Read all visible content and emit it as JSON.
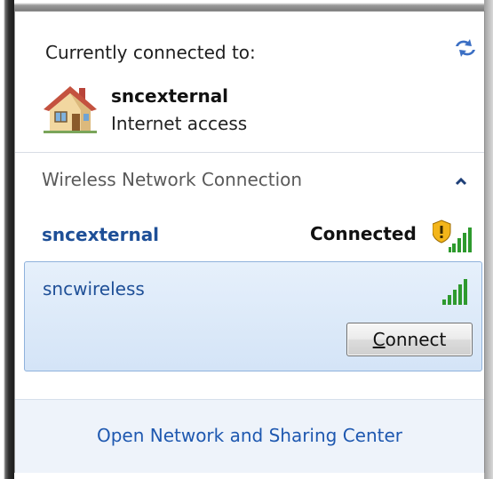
{
  "current": {
    "heading": "Currently connected to:",
    "network_name": "sncexternal",
    "network_status": "Internet access",
    "icons": {
      "refresh": "refresh-arrows-icon",
      "network": "house-icon"
    }
  },
  "wireless": {
    "section_title": "Wireless Network Connection",
    "collapse_icon": "chevron-up-icon",
    "networks": [
      {
        "name": "sncexternal",
        "status": "Connected",
        "icon": "secured-signal-strength-icon"
      },
      {
        "name": "sncwireless",
        "icon": "signal-strength-icon",
        "button_hotkey": "C",
        "button_rest": "onnect"
      }
    ]
  },
  "footer": {
    "link": "Open Network and Sharing Center"
  },
  "colors": {
    "link": "#1e58b0",
    "selected_bg": "#dce9f8",
    "signal": "#2e9a2e"
  }
}
